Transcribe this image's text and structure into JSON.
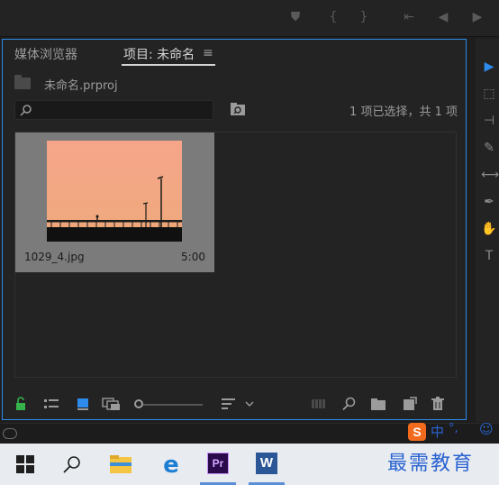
{
  "panel": {
    "tabs": [
      {
        "label": "媒体浏览器"
      },
      {
        "label": "项目: 未命名"
      }
    ],
    "menu_glyph": "≡",
    "project_file": "未命名.prproj",
    "search": {
      "placeholder": "",
      "value": ""
    },
    "selection_status": "1 项已选择，共 1 项",
    "clips": [
      {
        "name": "1029_4.jpg",
        "duration": "5:00"
      }
    ]
  },
  "ime": {
    "label": "中",
    "punct": "°,",
    "emoji": "☺"
  },
  "watermark": "最需教育",
  "taskbar": {
    "apps": [
      {
        "name": "start"
      },
      {
        "name": "search"
      },
      {
        "name": "file-explorer"
      },
      {
        "name": "edge"
      },
      {
        "name": "premiere-pro",
        "label": "Pr"
      },
      {
        "name": "word",
        "label": "W"
      }
    ]
  },
  "colors": {
    "accent": "#2d8ceb",
    "panel_bg": "#232323",
    "taskbar_bg": "#e8ecf1",
    "lock_green": "#36b34a",
    "pr_purple": "#2a0a4a",
    "word_blue": "#2b5797"
  }
}
